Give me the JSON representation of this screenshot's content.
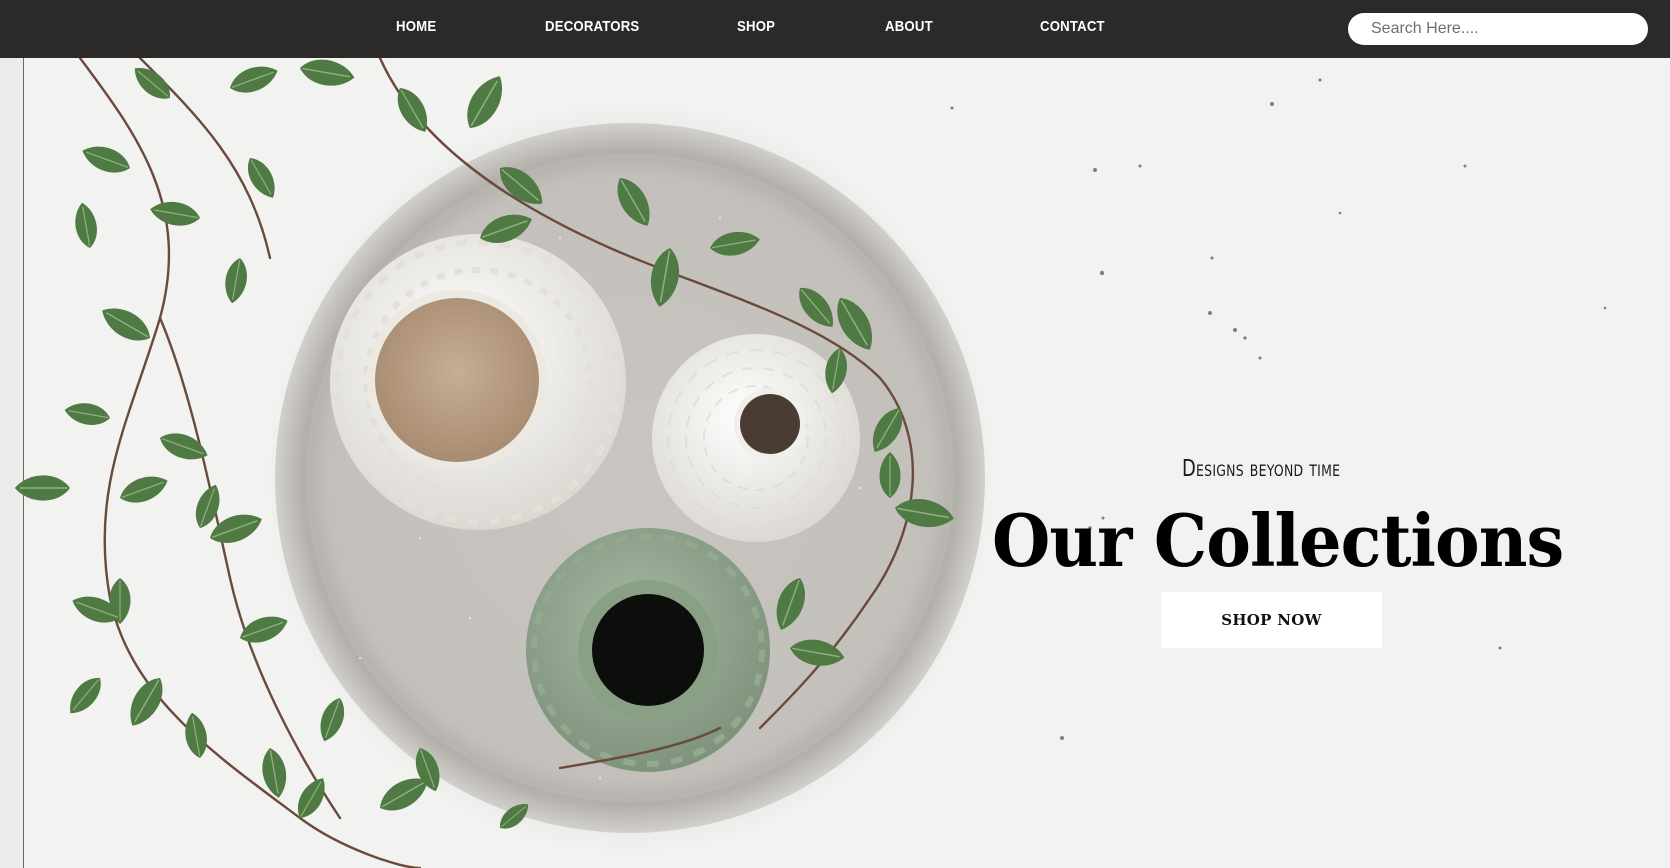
{
  "nav": {
    "items": [
      {
        "label": "HOME"
      },
      {
        "label": "DECORATORS"
      },
      {
        "label": "SHOP"
      },
      {
        "label": "ABOUT"
      },
      {
        "label": "CONTACT"
      }
    ]
  },
  "search": {
    "placeholder": "Search Here...."
  },
  "hero": {
    "tagline": "Designs beyond time",
    "title": "Our Collections",
    "button_label": "SHOP NOW",
    "image_description_icon": "vases-on-tray-with-ivy-photo"
  },
  "colors": {
    "navbar": "#2b2a28",
    "background": "#f1f1f0",
    "title_text": "#000000",
    "button_bg": "#ffffff"
  }
}
